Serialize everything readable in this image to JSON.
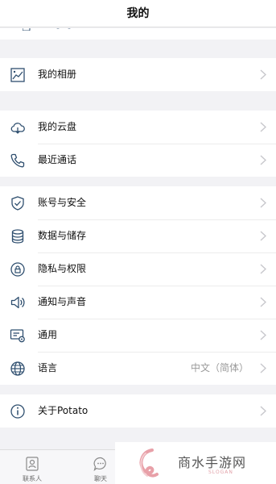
{
  "header": {
    "title": "我的"
  },
  "groups": [
    {
      "items": [
        {
          "icon": "image-chart-icon",
          "label": "我的相册"
        }
      ]
    },
    {
      "items": [
        {
          "icon": "cloud-icon",
          "label": "我的云盘"
        },
        {
          "icon": "phone-icon",
          "label": "最近通话"
        }
      ]
    },
    {
      "items": [
        {
          "icon": "shield-check-icon",
          "label": "账号与安全"
        },
        {
          "icon": "database-icon",
          "label": "数据与储存"
        },
        {
          "icon": "lock-icon",
          "label": "隐私与权限"
        },
        {
          "icon": "speaker-icon",
          "label": "通知与声音"
        },
        {
          "icon": "settings-card-icon",
          "label": "通用"
        },
        {
          "icon": "globe-icon",
          "label": "语言",
          "value": "中文（简体）"
        }
      ]
    },
    {
      "items": [
        {
          "icon": "info-icon",
          "label": "关于Potato"
        }
      ]
    }
  ],
  "tabbar": {
    "tabs": [
      {
        "icon": "contacts-icon",
        "label": "联系人"
      },
      {
        "icon": "chat-icon",
        "label": "聊天"
      }
    ]
  },
  "watermark": {
    "name": "商水手游网",
    "slogan": "SLOGAN"
  },
  "colors": {
    "icon": "#2f4f6f",
    "chevron": "#c7c7cc",
    "background": "#f2f2f5",
    "watermark_accent": "#e8a0a8"
  }
}
